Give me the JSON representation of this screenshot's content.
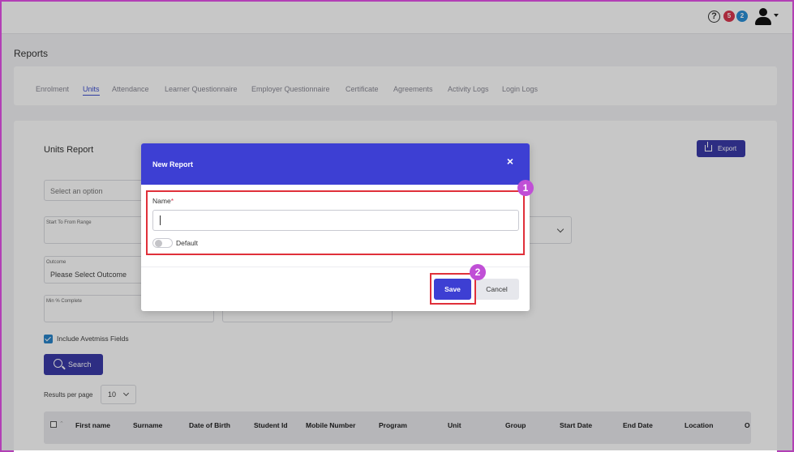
{
  "header": {
    "help_icon": "?",
    "badge_red": "5",
    "badge_blue": "2",
    "colors": {
      "badge_red": "#d9374f",
      "badge_blue": "#2a8fd6"
    }
  },
  "page": {
    "title": "Reports"
  },
  "tabs": [
    {
      "label": "Enrolment",
      "active": false
    },
    {
      "label": "Units",
      "active": true
    },
    {
      "label": "Attendance",
      "active": false
    },
    {
      "label": "Learner Questionnaire",
      "active": false
    },
    {
      "label": "Employer Questionnaire",
      "active": false
    },
    {
      "label": "Certificate",
      "active": false
    },
    {
      "label": "Agreements",
      "active": false
    },
    {
      "label": "Activity Logs",
      "active": false
    },
    {
      "label": "Login Logs",
      "active": false
    }
  ],
  "report": {
    "title": "Units Report",
    "export_label": "Export",
    "select_placeholder": "Select an option",
    "range_label": "Start To From Range",
    "outcome_label": "Outcome",
    "outcome_value": "Please Select Outcome",
    "min_complete_label": "Min % Complete",
    "avetmiss_label": "Include Avetmiss Fields",
    "search_label": "Search",
    "results_per_page_label": "Results per page",
    "results_per_page_value": "10"
  },
  "table": {
    "columns": [
      "First name",
      "Surname",
      "Date of Birth",
      "Student Id",
      "Mobile Number",
      "Program",
      "Unit",
      "Group",
      "Start Date",
      "End Date",
      "Location",
      "O"
    ]
  },
  "modal": {
    "title": "New Report",
    "close_icon": "×",
    "name_label": "Name",
    "required_mark": "*",
    "name_value": "",
    "default_label": "Default",
    "save_label": "Save",
    "cancel_label": "Cancel",
    "accent": "#3d3fd3"
  },
  "annotations": {
    "marker_1": "1",
    "marker_2": "2",
    "highlight_color": "#e0303a",
    "marker_color": "#c04fd6"
  }
}
